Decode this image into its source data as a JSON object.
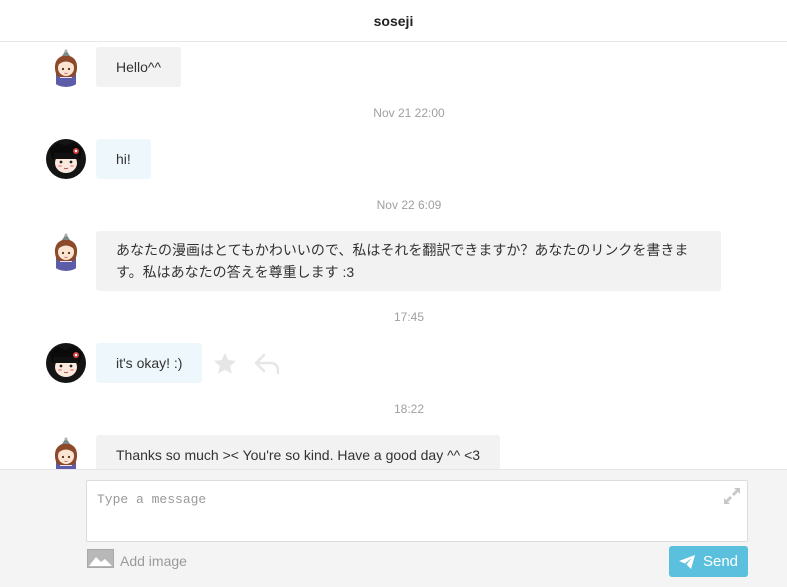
{
  "header": {
    "title": "soseji"
  },
  "messages": [
    {
      "text": "Hello^^"
    },
    {
      "text": "hi!"
    },
    {
      "lines": [
        "あなたの漫画はとてもかわいいので、私はそれを翻訳できますか？あなたのリンクを書きま",
        "す。私はあなたの答えを尊重します :3"
      ]
    },
    {
      "text": "it's okay! :)"
    },
    {
      "text": "Thanks so much >< You're so kind. Have a good day ^^ <3"
    }
  ],
  "timestamps": [
    "Nov 21 22:00",
    "Nov 22 6:09",
    "17:45",
    "18:22"
  ],
  "actions": {
    "star_icon": "star-icon",
    "reply_icon": "reply-icon"
  },
  "composer": {
    "placeholder": "Type a message",
    "add_image_label": "Add image",
    "send_label": "Send"
  },
  "colors": {
    "accent": "#5bc0de",
    "own_bubble": "#f2f2f2",
    "other_bubble": "#eef7fb"
  }
}
